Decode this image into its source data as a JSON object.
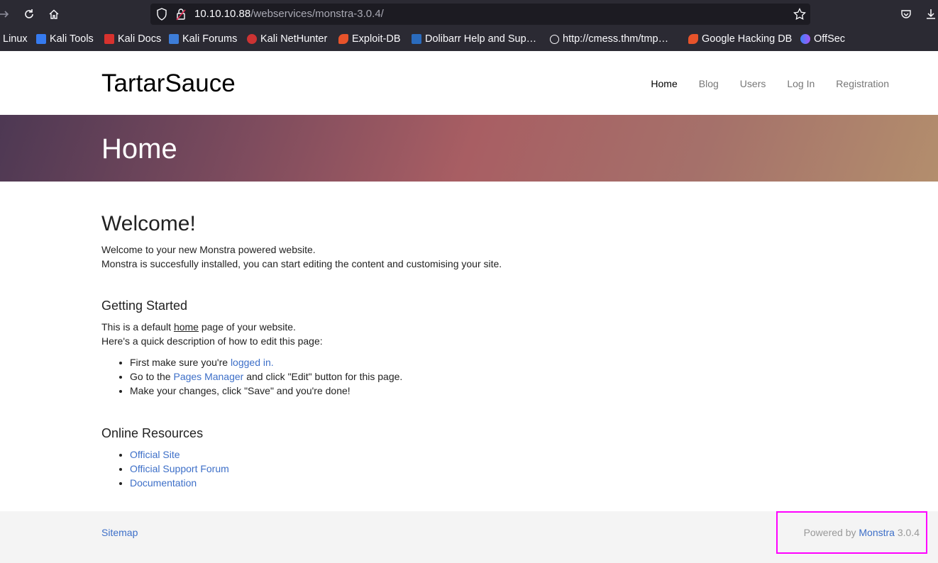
{
  "browser": {
    "url_host": "10.10.10.88",
    "url_path": "/webservices/monstra-3.0.4/",
    "bookmarks": [
      {
        "label": "Linux",
        "color": "#2b2a33"
      },
      {
        "label": "Kali Tools",
        "color": "#367bf0"
      },
      {
        "label": "Kali Docs",
        "color": "#d7322e"
      },
      {
        "label": "Kali Forums",
        "color": "#3d7dd8"
      },
      {
        "label": "Kali NetHunter",
        "color": "#cc3333"
      },
      {
        "label": "Exploit-DB",
        "color": "#e7532a"
      },
      {
        "label": "Dolibarr Help and Sup…",
        "color": "#2a6bbd"
      },
      {
        "label": "http://cmess.thm/tmp…",
        "color": "#fbfbfe"
      },
      {
        "label": "Google Hacking DB",
        "color": "#e7532a"
      },
      {
        "label": "OffSec",
        "color": "#5b6ee1"
      }
    ]
  },
  "site": {
    "logo": "TartarSauce",
    "nav": [
      "Home",
      "Blog",
      "Users",
      "Log In",
      "Registration"
    ],
    "hero_title": "Home"
  },
  "content": {
    "welcome_heading": "Welcome!",
    "welcome_line1": "Welcome to your new Monstra powered website.",
    "welcome_line2": "Monstra is succesfully installed, you can start editing the content and customising your site.",
    "getting_started_heading": "Getting Started",
    "gs_line1_pre": "This is a default ",
    "gs_line1_link": "home",
    "gs_line1_post": " page of your website.",
    "gs_line2": "Here's a quick description of how to edit this page:",
    "step1_pre": "First make sure you're ",
    "step1_link": "logged in.",
    "step2_pre": "Go to the ",
    "step2_link": "Pages Manager",
    "step2_post": " and click \"Edit\" button for this page.",
    "step3": "Make your changes, click \"Save\" and you're done!",
    "resources_heading": "Online Resources",
    "resources": [
      "Official Site",
      "Official Support Forum",
      "Documentation"
    ]
  },
  "footer": {
    "sitemap": "Sitemap",
    "powered_pre": "Powered by ",
    "powered_link": "Monstra",
    "version": " 3.0.4"
  }
}
